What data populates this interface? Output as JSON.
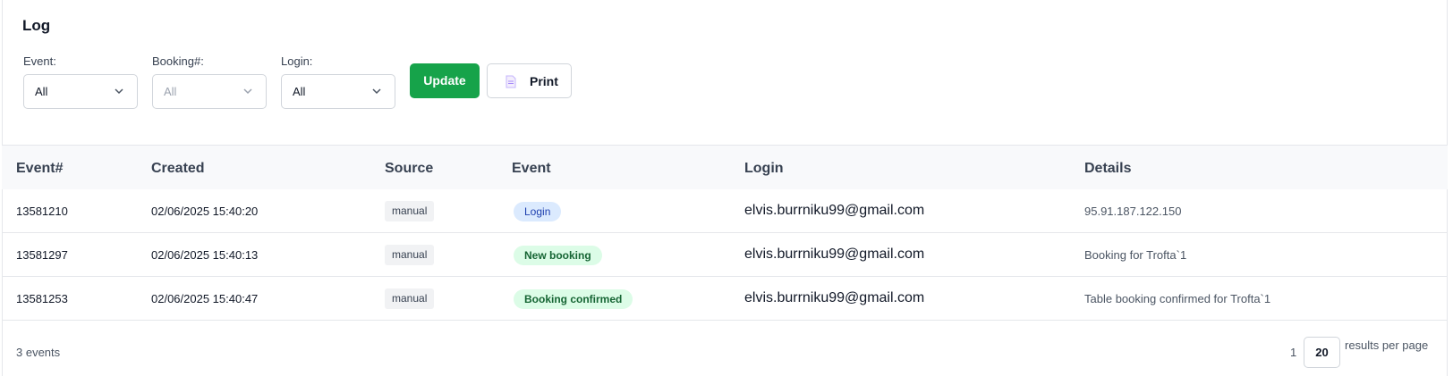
{
  "title": "Log",
  "filters": [
    {
      "label": "Event:",
      "value": "All",
      "disabled": false
    },
    {
      "label": "Booking#:",
      "value": "All",
      "disabled": true
    },
    {
      "label": "Login:",
      "value": "All",
      "disabled": false
    }
  ],
  "buttons": {
    "update": "Update",
    "print": "Print"
  },
  "table": {
    "headers": [
      "Event#",
      "Created",
      "Source",
      "Event",
      "Login",
      "Details"
    ],
    "rows": [
      {
        "id": "13581210",
        "created": "02/06/2025 15:40:20",
        "source": "manual",
        "event": "Login",
        "event_color": "#dbeafe",
        "login": "elvis.burrniku99@gmail.com",
        "details": "95.91.187.122.150"
      },
      {
        "id": "13581297",
        "created": "02/06/2025 15:40:13",
        "source": "manual",
        "event": "New booking",
        "event_color": "#dcfce7",
        "login": "elvis.burrniku99@gmail.com",
        "details": "Booking for Trofta`1"
      },
      {
        "id": "13581253",
        "created": "02/06/2025 15:40:47",
        "source": "manual",
        "event": "Booking confirmed",
        "event_color": "#dcfce7",
        "login": "elvis.burrniku99@gmail.com",
        "details": "Table booking confirmed for Trofta`1"
      }
    ]
  },
  "footer": {
    "count": "3 events",
    "page": "1",
    "per_page": "20",
    "per_page_label": "results per page"
  },
  "colors": {
    "accent": "#16a34a"
  }
}
